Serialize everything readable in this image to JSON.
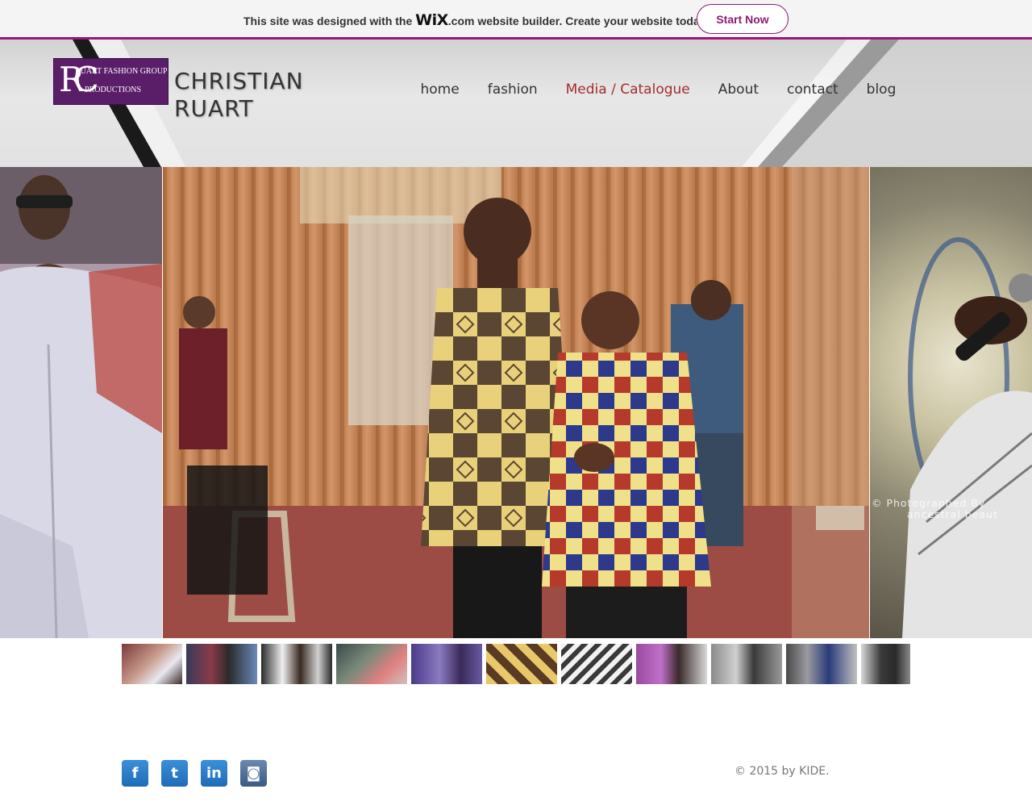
{
  "wix_banner": {
    "text_before": "This site was designed with the ",
    "wix_logo": "WiX",
    "text_after": ".com website builder. Create your website today.",
    "start_button": "Start Now",
    "accent": "#a0127a"
  },
  "header": {
    "logo": {
      "monogram": "RC",
      "line1": "RUART FASHION GROUP",
      "line2": "PRODUCTIONS",
      "bg_color": "#5a1e69"
    },
    "site_title_line1": "CHRISTIAN",
    "site_title_line2": "RUART",
    "nav": [
      {
        "label": "home"
      },
      {
        "label": "fashion"
      },
      {
        "label": "Media / Catalogue",
        "active": true
      },
      {
        "label": "About"
      },
      {
        "label": "contact"
      },
      {
        "label": "blog"
      }
    ],
    "active_color": "#a32d2d"
  },
  "slider": {
    "watermark_line1": "© Photographed By",
    "watermark_line2": "ancestral beaut"
  },
  "thumbnails_count": 11,
  "footer": {
    "social": [
      {
        "icon": "facebook-icon",
        "glyph": "f"
      },
      {
        "icon": "twitter-icon",
        "glyph": "t"
      },
      {
        "icon": "linkedin-icon",
        "glyph": "in"
      },
      {
        "icon": "instagram-icon",
        "glyph": "◙"
      }
    ],
    "copyright": "© 2015 by KIDE."
  }
}
